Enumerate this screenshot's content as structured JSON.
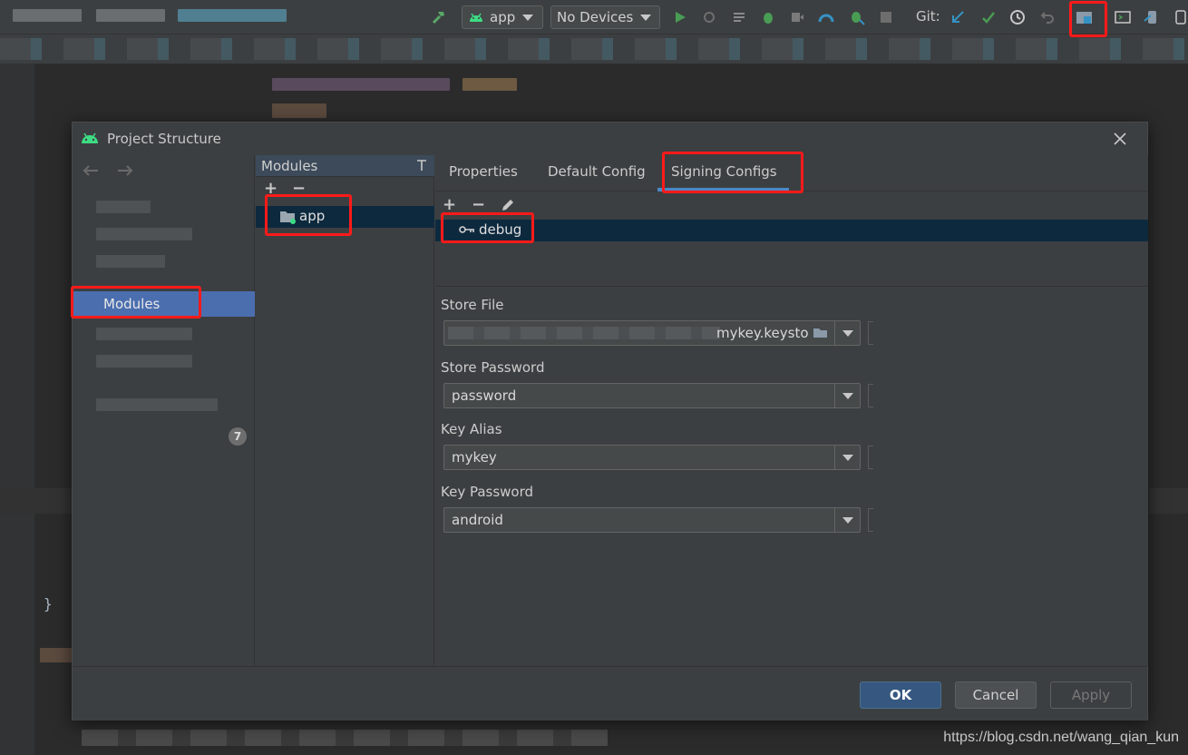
{
  "toolbar": {
    "run_config": "app",
    "device": "No Devices",
    "git_label": "Git:"
  },
  "dialog": {
    "title": "Project Structure",
    "nav": {
      "selected": "Modules",
      "badge": "7"
    },
    "modules_panel": {
      "header": "Modules",
      "add": "+",
      "remove": "−",
      "module": "app"
    },
    "tabs": [
      "Properties",
      "Default Config",
      "Signing Configs"
    ],
    "signing": {
      "add": "+",
      "remove": "−",
      "config": "debug",
      "fields": [
        {
          "label": "Store File",
          "value": "mykey.keysto"
        },
        {
          "label": "Store Password",
          "value": "password"
        },
        {
          "label": "Key Alias",
          "value": "mykey"
        },
        {
          "label": "Key Password",
          "value": "android"
        }
      ]
    },
    "buttons": {
      "ok": "OK",
      "cancel": "Cancel",
      "apply": "Apply"
    }
  },
  "editor": {
    "closing_brace": "}"
  },
  "watermark": "https://blog.csdn.net/wang_qian_kun",
  "colors": {
    "accent": "#4a88c7",
    "selection": "#4b6eaf",
    "highlight": "#ff1a1a",
    "primary_button": "#365880"
  }
}
